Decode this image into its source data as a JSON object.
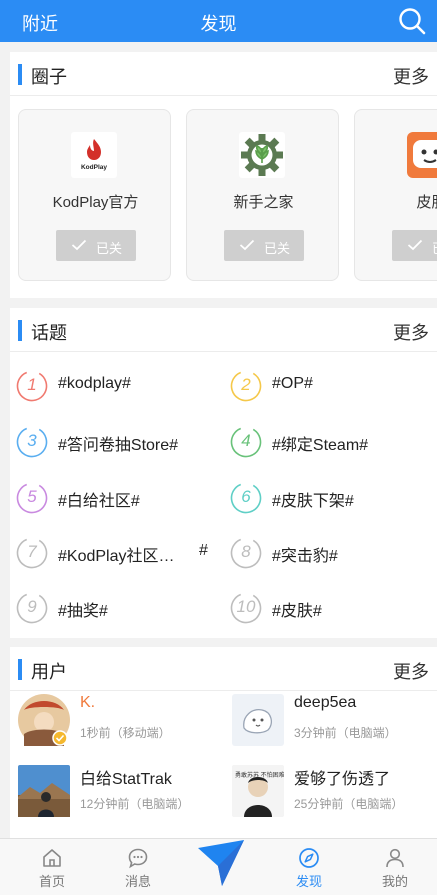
{
  "header": {
    "left": "附近",
    "title": "发现",
    "search_icon": "search-icon"
  },
  "circles": {
    "title": "圈子",
    "more": "更多",
    "items": [
      {
        "name": "KodPlay官方",
        "button": "已关",
        "icon": "kodplay-logo",
        "logo_text": "KodPlay"
      },
      {
        "name": "新手之家",
        "button": "已关",
        "icon": "gear-leaf-logo"
      },
      {
        "name": "皮肤",
        "button": "已关",
        "icon": "skin-logo"
      }
    ]
  },
  "topics": {
    "title": "话题",
    "more": "更多",
    "items": [
      {
        "num": "1",
        "text": "#kodplay#",
        "color": "#f07a70"
      },
      {
        "num": "2",
        "text": "#OP#",
        "color": "#f5c84a"
      },
      {
        "num": "3",
        "text": "#答问卷抽Store#",
        "color": "#5aaef0"
      },
      {
        "num": "4",
        "text": "#绑定Steam#",
        "color": "#69c27a"
      },
      {
        "num": "5",
        "text": "#白给社区#",
        "color": "#c98ae0"
      },
      {
        "num": "6",
        "text": "#皮肤下架#",
        "color": "#5fcfc6"
      },
      {
        "num": "7",
        "text": "#KodPlay社区…",
        "suffix": "#",
        "color": "#bdbdbd"
      },
      {
        "num": "8",
        "text": "#突击豹#",
        "color": "#bdbdbd"
      },
      {
        "num": "9",
        "text": "#抽奖#",
        "color": "#bdbdbd"
      },
      {
        "num": "10",
        "text": "#皮肤#",
        "color": "#bdbdbd"
      }
    ]
  },
  "users": {
    "title": "用户",
    "more": "更多",
    "items": [
      {
        "name": "K.",
        "time": "1秒前（移动端）",
        "name_color": "#f07a3c"
      },
      {
        "name": "deep5ea",
        "time": "3分钟前（电脑端）",
        "name_color": "#222222"
      },
      {
        "name": "白给StatTrak",
        "time": "12分钟前（电脑端）",
        "name_color": "#222222"
      },
      {
        "name": "爱够了伤透了",
        "time": "25分钟前（电脑端）",
        "name_color": "#222222",
        "avatar_text": "勇敢苏苏 不怕困难"
      }
    ]
  },
  "tabs": [
    {
      "label": "首页",
      "icon": "home-icon"
    },
    {
      "label": "消息",
      "icon": "chat-icon"
    },
    {
      "label": "",
      "icon": "paper-plane-icon"
    },
    {
      "label": "发现",
      "icon": "compass-icon",
      "active": true
    },
    {
      "label": "我的",
      "icon": "person-icon"
    }
  ],
  "colors": {
    "accent": "#2b8cf4"
  }
}
